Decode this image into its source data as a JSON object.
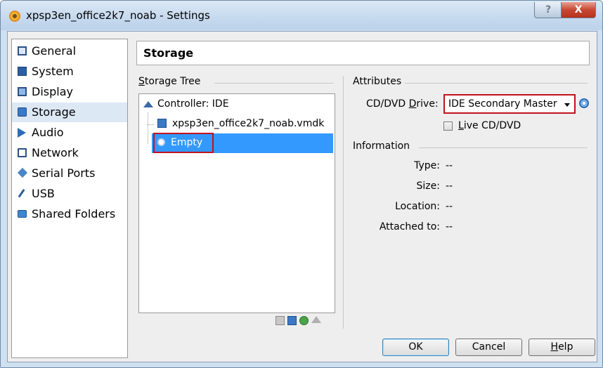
{
  "window": {
    "title": "xpsp3en_office2k7_noab - Settings",
    "help_glyph": "?",
    "close_glyph": "X"
  },
  "sidebar": {
    "items": [
      {
        "label": "General",
        "icon": "monitor-icon"
      },
      {
        "label": "System",
        "icon": "chip-icon"
      },
      {
        "label": "Display",
        "icon": "display-icon"
      },
      {
        "label": "Storage",
        "icon": "disk-icon",
        "selected": true
      },
      {
        "label": "Audio",
        "icon": "speaker-icon"
      },
      {
        "label": "Network",
        "icon": "network-icon"
      },
      {
        "label": "Serial Ports",
        "icon": "serial-port-icon"
      },
      {
        "label": "USB",
        "icon": "usb-icon"
      },
      {
        "label": "Shared Folders",
        "icon": "folder-icon"
      }
    ]
  },
  "page": {
    "title": "Storage"
  },
  "storage_tree": {
    "label_prefix": "S",
    "label_rest": "torage Tree",
    "controller": "Controller: IDE",
    "disk": "xpsp3en_office2k7_noab.vmdk",
    "cd": "Empty",
    "toolbar": [
      "add-controller-icon",
      "remove-controller-icon",
      "add-attachment-icon",
      "remove-attachment-icon"
    ]
  },
  "attributes": {
    "label": "Attributes",
    "cd_drive_label_a": "CD/DVD ",
    "cd_drive_label_u": "D",
    "cd_drive_label_b": "rive:",
    "cd_drive_value": "IDE Secondary Master",
    "live_cd_u": "L",
    "live_cd_rest": "ive CD/DVD",
    "live_cd_checked": false
  },
  "information": {
    "label": "Information",
    "rows": [
      {
        "label": "Type:",
        "value": "--"
      },
      {
        "label": "Size:",
        "value": "--"
      },
      {
        "label": "Location:",
        "value": "--"
      },
      {
        "label": "Attached to:",
        "value": "--"
      }
    ]
  },
  "buttons": {
    "ok": "OK",
    "cancel": "Cancel",
    "help_u": "H",
    "help_rest": "elp"
  },
  "colors": {
    "selection": "#3399ff",
    "highlight_border": "#c0121c"
  }
}
